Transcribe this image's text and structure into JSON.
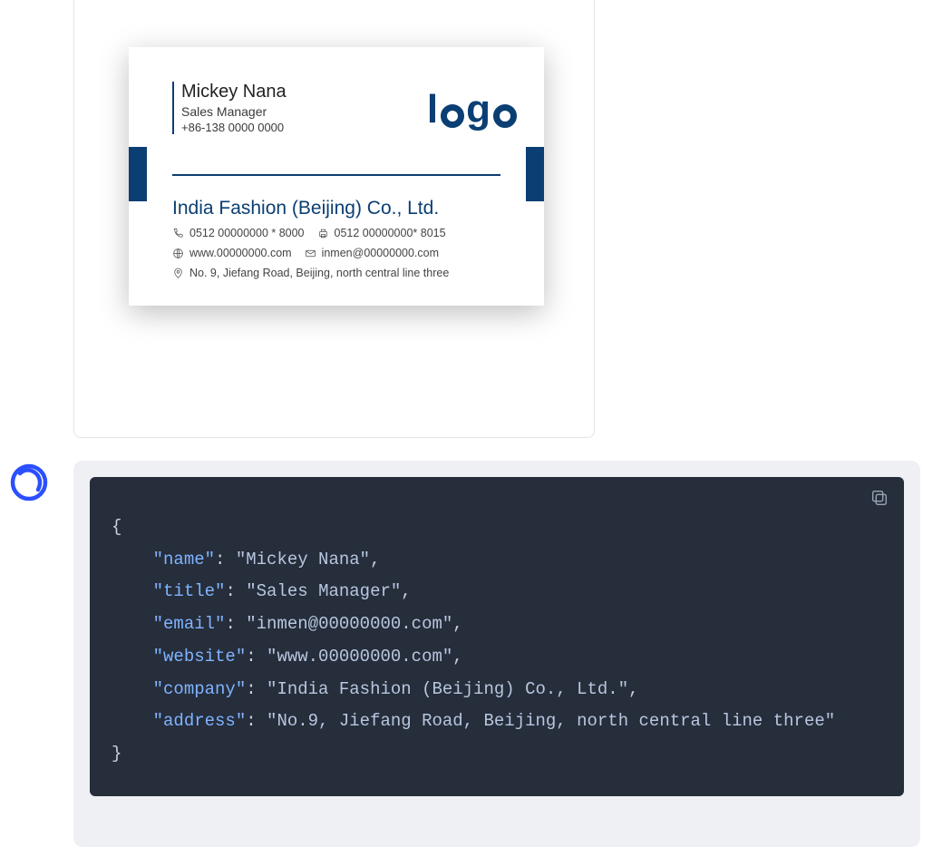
{
  "card": {
    "name": "Mickey Nana",
    "title": "Sales Manager",
    "phone": "+86-138 0000 0000",
    "logo_text_l": "l",
    "logo_text_g": "g",
    "logo_text_o2": "o",
    "company": "India Fashion (Beijing) Co., Ltd.",
    "tel": "0512 00000000 * 8000",
    "fax": "0512 00000000* 8015",
    "website": "www.00000000.com",
    "email": "inmen@00000000.com",
    "address": "No. 9, Jiefang Road, Beijing, north central line three"
  },
  "code": {
    "brace_open": "{",
    "brace_close": "}",
    "colon_sep": ": ",
    "comma": ",",
    "k_name": "\"name\"",
    "v_name": "\"Mickey Nana\"",
    "k_title": "\"title\"",
    "v_title": "\"Sales Manager\"",
    "k_email": "\"email\"",
    "v_email": "\"inmen@00000000.com\"",
    "k_website": "\"website\"",
    "v_website": "\"www.00000000.com\"",
    "k_company": "\"company\"",
    "v_company": "\"India Fashion (Beijing) Co., Ltd.\"",
    "k_address": "\"address\"",
    "v_address": "\"No.9, Jiefang Road, Beijing, north central line three\""
  }
}
